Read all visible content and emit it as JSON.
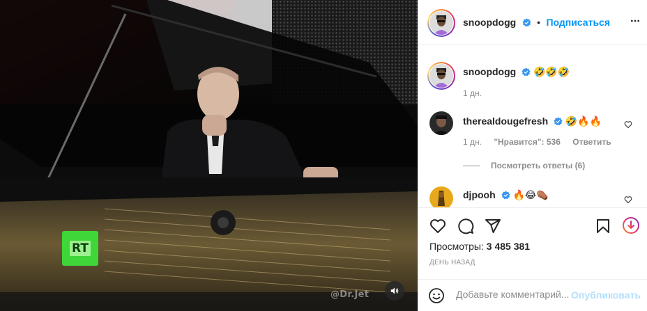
{
  "media": {
    "watermark": "@Dr.Jet",
    "channel_logo": "RT"
  },
  "header": {
    "username": "snoopdogg",
    "separator": "•",
    "follow_label": "Подписаться"
  },
  "caption": {
    "username": "snoopdogg",
    "emojis": "🤣🤣🤣",
    "time": "1 дн."
  },
  "comments": [
    {
      "username": "therealdougefresh",
      "emojis": "🤣🔥🔥",
      "time": "1 дн.",
      "likes": "\"Нравится\": 536",
      "reply_label": "Ответить",
      "view_replies": "Посмотреть ответы (6)"
    },
    {
      "username": "djpooh",
      "emojis": "🔥😂⚰️"
    }
  ],
  "stats": {
    "views_label": "Просмотры:",
    "views_value": "3 485 381",
    "date": "ДЕНЬ НАЗАД"
  },
  "comment_box": {
    "placeholder": "Добавьте комментарий...",
    "publish_label": "Опубликовать"
  },
  "colors": {
    "accent": "#0095f6",
    "verified": "#3897f0",
    "muted": "#8e8e8e",
    "publish_disabled": "#b2dffc"
  },
  "icons": [
    "verified-icon",
    "more-icon",
    "heart-icon",
    "comment-icon",
    "share-icon",
    "bookmark-icon",
    "boost-icon",
    "emoji-icon",
    "volume-icon"
  ]
}
